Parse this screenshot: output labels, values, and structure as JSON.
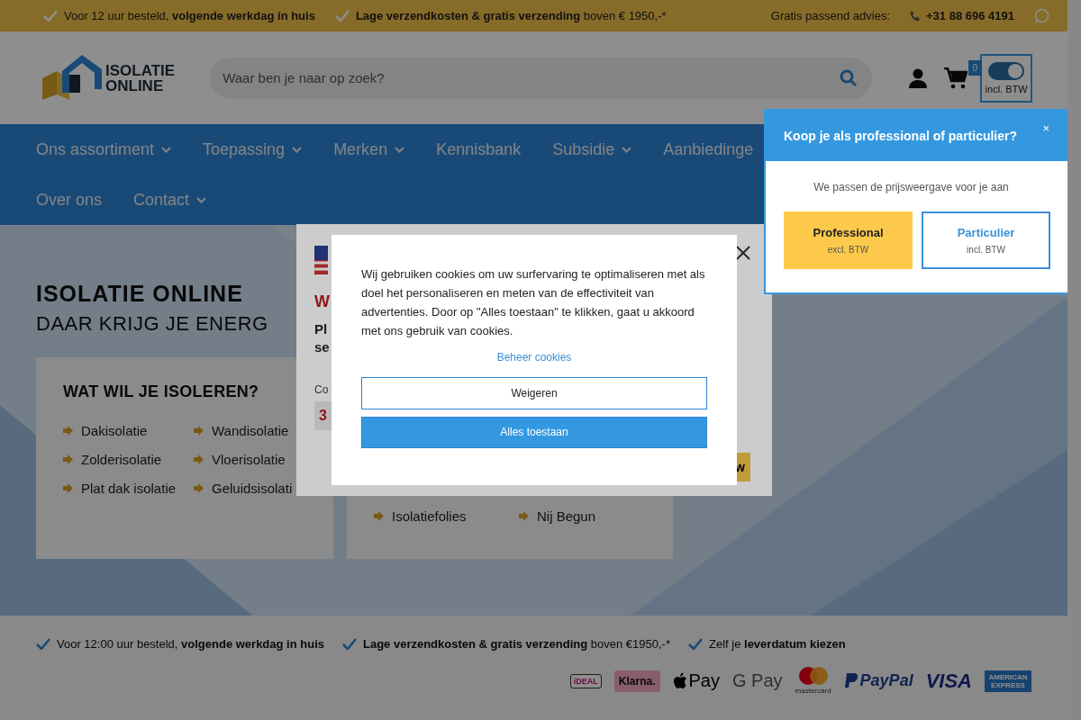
{
  "top_bar": {
    "usps": [
      "Voor 12 uur besteld, **volgende werkdag in huis**",
      "**Lage verzendkosten & gratis verzending** boven € 1950,-*"
    ],
    "advice_label": "Gratis passend advies:",
    "phone": "+31 88 696 4191"
  },
  "header": {
    "logo": {
      "line_1": "ISOLATIE",
      "line_2": "ONLINE"
    },
    "search": {
      "placeholder": "Waar ben je naar op zoek?"
    },
    "cart_count": "0",
    "price_toggle": {
      "on": true,
      "label": "incl. BTW"
    }
  },
  "nav": {
    "rows": [
      [
        {
          "label": "Ons assortiment",
          "expandable": true
        },
        {
          "label": "Toepassing",
          "expandable": true
        },
        {
          "label": "Merken",
          "expandable": true
        },
        {
          "label": "Kennisbank",
          "expandable": false
        },
        {
          "label": "Subsidie",
          "expandable": true
        },
        {
          "label": "Aanbiedinge",
          "expandable": false
        }
      ],
      [
        {
          "label": "Over ons",
          "expandable": false
        },
        {
          "label": "Contact",
          "expandable": true
        }
      ]
    ]
  },
  "hero": {
    "title": "ISOLATIE ONLINE",
    "subtitle": "DAAR KRIJG JE ENERG",
    "cards": [
      {
        "heading": "WAT WIL JE ISOLEREN?",
        "items": [
          "Dakisolatie",
          "Wandisolatie",
          "Zolderisolatie",
          "Vloerisolatie",
          "Plat dak isolatie",
          "Geluidsisolati"
        ]
      },
      {
        "items": [
          "Isolatiefolies",
          "Nij Begun"
        ]
      }
    ]
  },
  "footer": {
    "usps": [
      "Voor 12:00 uur besteld, **volgende werkdag in huis**",
      "**Lage verzendkosten & gratis verzending** boven €1950,-*",
      "Zelf je **leverdatum kiezen**"
    ],
    "payment_methods": [
      {
        "kind": "ideal",
        "label": "iDEAL"
      },
      {
        "kind": "klarna",
        "label": "Klarna."
      },
      {
        "kind": "applepay",
        "label": "Pay"
      },
      {
        "kind": "googlepay",
        "label": "G Pay"
      },
      {
        "kind": "mastercard",
        "label": "mastercard"
      },
      {
        "kind": "paypal",
        "label": "PayPal"
      },
      {
        "kind": "visa",
        "label": "VISA"
      },
      {
        "kind": "amex",
        "label": "AMERICAN EXPRESS"
      }
    ]
  },
  "country_dialog": {
    "heading": "W",
    "text_lines": [
      "Pl",
      "se"
    ],
    "field_label": "Co",
    "field_value": "3",
    "button": "w"
  },
  "cookie_dialog": {
    "text": "Wij gebruiken cookies om uw surfervaring te optimaliseren met als doel het personaliseren en meten van de effectiviteit van advertenties. Door op \"Alles toestaan\" te klikken, gaat u akkoord met ons gebruik van cookies.",
    "manage_link": "Beheer cookies",
    "buttons": [
      {
        "label": "Weigeren",
        "kind": "outlined"
      },
      {
        "label": "Alles toestaan",
        "kind": "filled"
      }
    ]
  },
  "customer_popover": {
    "title": "Koop je als professional of particulier?",
    "close": "×",
    "text": "We passen de prijsweergave voor je aan",
    "options": [
      {
        "label": "Professional",
        "note": "excl. BTW",
        "kind": "filled"
      },
      {
        "label": "Particulier",
        "note": "incl. BTW",
        "kind": "outlined"
      }
    ]
  }
}
